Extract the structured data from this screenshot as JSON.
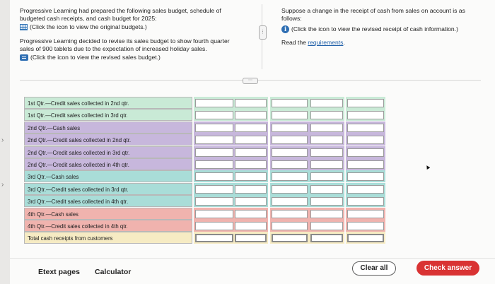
{
  "intro": {
    "line1": "Progressive Learning had prepared the following sales budget, schedule of",
    "line2": "budgeted cash receipts, and cash budget for 2025:",
    "original_link": "(Click the icon to view the original budgets.)",
    "para2_line1": "Progressive Learning decided to revise its sales budget to show fourth quarter",
    "para2_line2": "sales of 900 tablets due to the expectation of increased holiday sales.",
    "revised_link": "(Click the icon to view the revised sales budget.)"
  },
  "right_panel": {
    "line1": "Suppose a change in the receipt of cash from sales on account is as",
    "line2": "follows:",
    "info_link": "(Click the icon to view the revised receipt of cash information.)",
    "read_prefix": "Read the ",
    "requirements_link": "requirements",
    "period": "."
  },
  "table": {
    "rows": [
      {
        "label": "1st Qtr.—Credit sales collected in 2nd qtr.",
        "color": "#c9ead6"
      },
      {
        "label": "1st Qtr.—Credit sales collected in 3rd qtr.",
        "color": "#c9ead6"
      },
      {
        "label": "2nd Qtr.—Cash sales",
        "color": "#c7b7dc"
      },
      {
        "label": "2nd Qtr.—Credit sales collected in 2nd qtr.",
        "color": "#c7b7dc"
      },
      {
        "label": "2nd Qtr.—Credit sales collected in 3rd qtr.",
        "color": "#c7b7dc"
      },
      {
        "label": "2nd Qtr.—Credit sales collected in 4th qtr.",
        "color": "#c7b7dc"
      },
      {
        "label": "3rd Qtr.—Cash sales",
        "color": "#a9ddd8"
      },
      {
        "label": "3rd Qtr.—Credit sales collected in 3rd qtr.",
        "color": "#a9ddd8"
      },
      {
        "label": "3rd Qtr.—Credit sales collected in 4th qtr.",
        "color": "#a9ddd8"
      },
      {
        "label": "4th Qtr.—Cash sales",
        "color": "#f0b3ae"
      },
      {
        "label": "4th Qtr.—Credit sales collected in 4th qtr.",
        "color": "#f0b3ae"
      },
      {
        "label": "Total cash receipts from customers",
        "color": "#f6ebc3"
      }
    ]
  },
  "footer": {
    "etext": "Etext pages",
    "calculator": "Calculator",
    "clear_all": "Clear all",
    "check_answer": "Check answer"
  },
  "colors": {
    "check_button": "#d93333",
    "link": "#1f5fa8"
  }
}
